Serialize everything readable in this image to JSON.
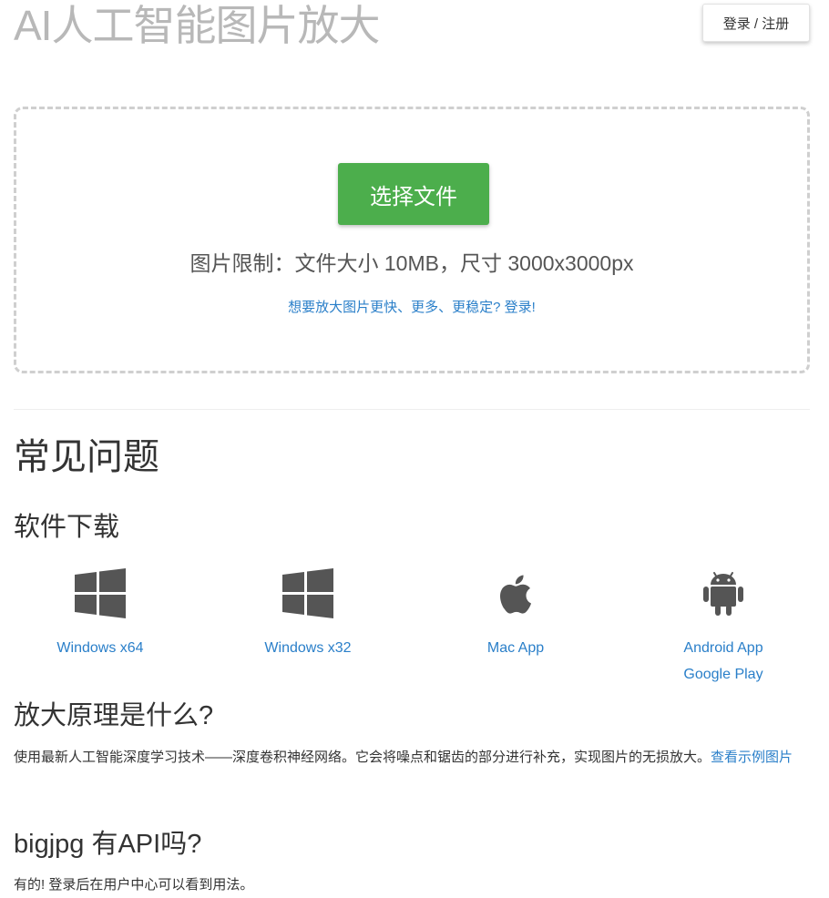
{
  "header": {
    "site_title": "AI人工智能图片放大",
    "login_button": "登录 / 注册"
  },
  "upload": {
    "choose_button": "选择文件",
    "limit_text": "图片限制：文件大小 10MB，尺寸 3000x3000px",
    "login_prompt": "想要放大图片更快、更多、更稳定? 登录!"
  },
  "faq": {
    "title": "常见问题",
    "downloads_heading": "软件下载",
    "downloads": [
      {
        "icon": "windows-icon",
        "label": "Windows x64"
      },
      {
        "icon": "windows-icon",
        "label": "Windows x32"
      },
      {
        "icon": "apple-icon",
        "label": "Mac App"
      },
      {
        "icon": "android-icon",
        "label": "Android App",
        "label2": "Google Play"
      }
    ],
    "principle_heading": "放大原理是什么?",
    "principle_text": "使用最新人工智能深度学习技术——深度卷积神经网络。它会将噪点和锯齿的部分进行补充，实现图片的无损放大。",
    "principle_link": "查看示例图片",
    "api_heading": "bigjpg 有API吗?",
    "api_text": "有的! 登录后在用户中心可以看到用法。"
  },
  "colors": {
    "title_gray": "#b8b8b8",
    "button_green": "#4cae4c",
    "link_blue": "#2a7fc9",
    "icon_gray": "#555555"
  }
}
